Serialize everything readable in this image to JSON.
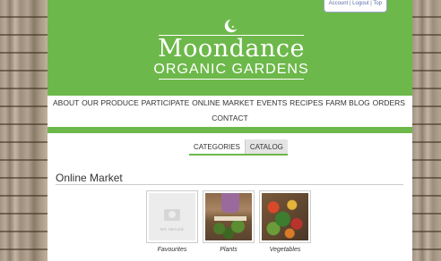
{
  "account_bar": {
    "text": "Account | Logout | Top"
  },
  "logo": {
    "title": "Moondance",
    "subtitle": "ORGANIC GARDENS"
  },
  "nav": {
    "row1": [
      "ABOUT",
      "OUR PRODUCE",
      "PARTICIPATE",
      "ONLINE MARKET",
      "EVENTS",
      "RECIPES",
      "FARM BLOG",
      "ORDERS"
    ],
    "row2": [
      "CONTACT"
    ]
  },
  "tabs": [
    {
      "label": "CATEGORIES",
      "active": false
    },
    {
      "label": "CATALOG",
      "active": true
    }
  ],
  "section": {
    "title": "Online Market"
  },
  "products": [
    {
      "caption": "Favourites",
      "image": "no-image",
      "placeholder_text": "NO IMAGE"
    },
    {
      "caption": "Plants",
      "image": "plants-photo"
    },
    {
      "caption": "Vegetables",
      "image": "vegetables-photo"
    }
  ],
  "colors": {
    "brand_green": "#6db84a",
    "page_bg": "#ffffff"
  },
  "icons": {
    "logo_mark": "crescent-moon-icon"
  }
}
